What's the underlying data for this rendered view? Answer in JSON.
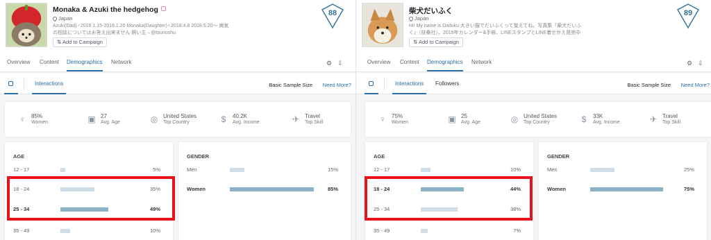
{
  "panels": [
    {
      "name": "Monaka & Azuki the hedgehog",
      "location": "Japan",
      "bio_lines": [
        "Azuki(Dad)♂2016.1.15-2019.1.20 Monaka(Daughter)♀2018.4.8 2018.5.20〜 病気",
        "の相談についてはお答え出来ません 飼い主→@tsunoshu"
      ],
      "add_campaign": "Add to Campaign",
      "score": "88",
      "tabs": [
        "Overview",
        "Content",
        "Demographics",
        "Network"
      ],
      "active_tab": "Demographics",
      "subtabs": [
        "Interactions"
      ],
      "basic_sample": "Basic Sample Size",
      "need_more": "Need More?",
      "stats": [
        {
          "icon": "female-icon",
          "value": "85%",
          "label": "Women"
        },
        {
          "icon": "cake-icon",
          "value": "27",
          "label": "Avg. Age"
        },
        {
          "icon": "globe-icon",
          "value": "United States",
          "label": "Top Country"
        },
        {
          "icon": "dollar-icon",
          "value": "40.2K",
          "label": "Avg. Income"
        },
        {
          "icon": "plane-icon",
          "value": "Travel",
          "label": "Top Skill"
        }
      ],
      "age_title": "AGE",
      "age_rows": [
        {
          "label": "12 - 17",
          "value": "5%",
          "pct": 5,
          "bold": false
        },
        {
          "label": "18 - 24",
          "value": "35%",
          "pct": 35,
          "bold": false
        },
        {
          "label": "25 - 34",
          "value": "49%",
          "pct": 49,
          "bold": true
        },
        {
          "label": "35 - 49",
          "value": "10%",
          "pct": 10,
          "bold": false
        }
      ],
      "gender_title": "GENDER",
      "gender_rows": [
        {
          "label": "Men",
          "value": "15%",
          "pct": 15,
          "bold": false
        },
        {
          "label": "Women",
          "value": "85%",
          "pct": 85,
          "bold": true
        }
      ]
    },
    {
      "name": "柴犬だいふく",
      "location": "Japan",
      "bio_lines": [
        "Hi! My name is Daifuku 大きい猫でだいふくって覚えてね。写真集『柴犬だいふ",
        "く』（扶桑社）、2019年カレンダー&手帳、LINEスタンプとLINE着せかえ発売中"
      ],
      "add_campaign": "Add to Campaign",
      "score": "89",
      "tabs": [
        "Overview",
        "Content",
        "Demographics",
        "Network"
      ],
      "active_tab": "Demographics",
      "subtabs": [
        "Interactions",
        "Followers"
      ],
      "basic_sample": "Basic Sample Size",
      "need_more": "Need More?",
      "stats": [
        {
          "icon": "female-icon",
          "value": "75%",
          "label": "Women"
        },
        {
          "icon": "cake-icon",
          "value": "25",
          "label": "Avg. Age"
        },
        {
          "icon": "globe-icon",
          "value": "United States",
          "label": "Top Country"
        },
        {
          "icon": "dollar-icon",
          "value": "33K",
          "label": "Avg. Income"
        },
        {
          "icon": "plane-icon",
          "value": "Travel",
          "label": "Top Skill"
        }
      ],
      "age_title": "AGE",
      "age_rows": [
        {
          "label": "12 - 17",
          "value": "10%",
          "pct": 10,
          "bold": false
        },
        {
          "label": "18 - 24",
          "value": "44%",
          "pct": 44,
          "bold": true
        },
        {
          "label": "25 - 34",
          "value": "38%",
          "pct": 38,
          "bold": false
        },
        {
          "label": "35 - 49",
          "value": "7%",
          "pct": 7,
          "bold": false
        }
      ],
      "gender_title": "GENDER",
      "gender_rows": [
        {
          "label": "Men",
          "value": "25%",
          "pct": 25,
          "bold": false
        },
        {
          "label": "Women",
          "value": "75%",
          "pct": 75,
          "bold": true
        }
      ]
    }
  ],
  "colors": {
    "accent": "#2a6ea8",
    "highlight_box": "#e8131a",
    "bar": "#cfdde6",
    "bar_bold": "#8ab3c8"
  }
}
